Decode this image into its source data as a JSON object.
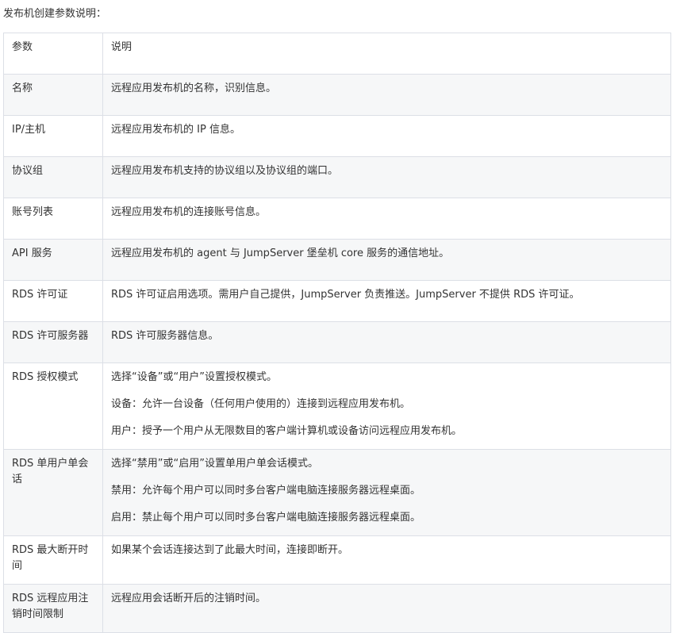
{
  "intro": "发布机创建参数说明：",
  "table": {
    "headers": [
      "参数",
      "说明"
    ],
    "rows": [
      {
        "param": "名称",
        "desc": [
          "远程应用发布机的名称，识别信息。"
        ]
      },
      {
        "param": "IP/主机",
        "desc": [
          "远程应用发布机的 IP 信息。"
        ]
      },
      {
        "param": "协议组",
        "desc": [
          "远程应用发布机支持的协议组以及协议组的端口。"
        ]
      },
      {
        "param": "账号列表",
        "desc": [
          "远程应用发布机的连接账号信息。"
        ]
      },
      {
        "param": "API 服务",
        "desc": [
          "远程应用发布机的 agent 与 JumpServer 堡垒机 core 服务的通信地址。"
        ]
      },
      {
        "param": "RDS 许可证",
        "desc": [
          "RDS 许可证启用选项。需用户自己提供，JumpServer 负责推送。JumpServer 不提供 RDS 许可证。"
        ]
      },
      {
        "param": "RDS 许可服务器",
        "desc": [
          "RDS 许可服务器信息。"
        ]
      },
      {
        "param": "RDS 授权模式",
        "desc": [
          "选择“设备”或“用户”设置授权模式。",
          "设备：允许一台设备（任何用户使用的）连接到远程应用发布机。",
          "用户：授予一个用户从无限数目的客户端计算机或设备访问远程应用发布机。"
        ]
      },
      {
        "param": "RDS 单用户单会话",
        "desc": [
          "选择“禁用”或“启用”设置单用户单会话模式。",
          "禁用：允许每个用户可以同时多台客户端电脑连接服务器远程桌面。",
          "启用：禁止每个用户可以同时多台客户端电脑连接服务器远程桌面。"
        ]
      },
      {
        "param": "RDS 最大断开时间",
        "desc": [
          "如果某个会话连接达到了此最大时间，连接即断开。"
        ]
      },
      {
        "param": "RDS 远程应用注销时间限制",
        "desc": [
          "远程应用会话断开后的注销时间。"
        ]
      }
    ]
  }
}
